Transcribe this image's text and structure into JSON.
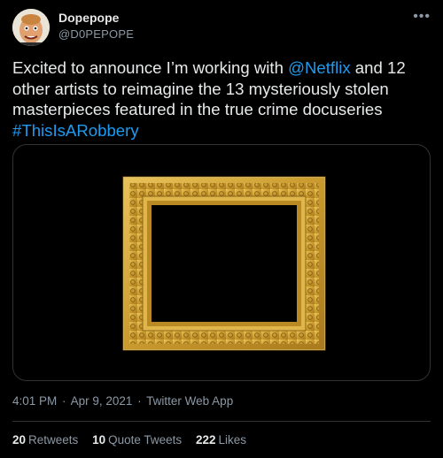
{
  "user": {
    "name": "Dopepope",
    "handle": "@D0PEPOPE"
  },
  "tweet": {
    "text_1": "Excited to announce I’m working with ",
    "mention": "@Netflix",
    "text_2": " and 12 other artists to reimagine the 13 mysteriously stolen masterpieces featured in the true crime docuseries ",
    "hashtag": "#ThisIsARobbery"
  },
  "meta": {
    "time": "4:01 PM",
    "date": "Apr 9, 2021",
    "source": "Twitter Web App",
    "sep": "·"
  },
  "stats": {
    "retweets_count": "20",
    "retweets_label": "Retweets",
    "quotes_count": "10",
    "quotes_label": "Quote Tweets",
    "likes_count": "222",
    "likes_label": "Likes"
  },
  "icons": {
    "more": "more-icon"
  },
  "colors": {
    "background": "#000000",
    "link": "#1d9bf0",
    "secondary": "#8b98a5",
    "frame_gold": "#c9a23a"
  }
}
